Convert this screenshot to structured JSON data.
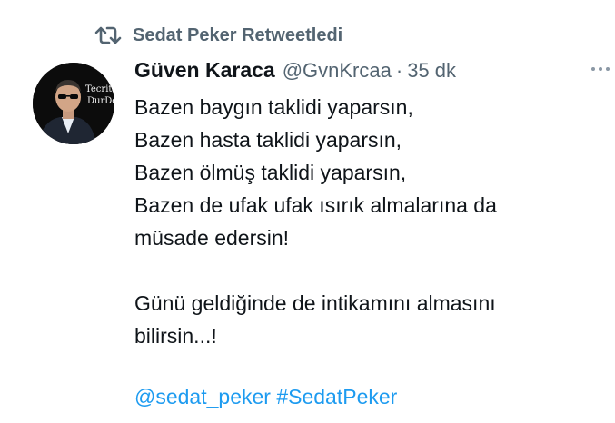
{
  "retweet": {
    "icon": "retweet-icon",
    "label": "Sedat Peker Retweetledi"
  },
  "author": {
    "avatar_text_top": "Tecrite",
    "avatar_text_bottom": "DurDe",
    "display_name": "Güven Karaca",
    "handle": "@GvnKrcaa",
    "separator": "·",
    "time": "35 dk"
  },
  "more_icon": "more-horizontal-icon",
  "tweet": {
    "lines": [
      "Bazen baygın taklidi yaparsın,",
      "Bazen hasta taklidi yaparsın,",
      "Bazen ölmüş taklidi yaparsın,",
      "Bazen de ufak ufak ısırık almalarına da",
      "müsade edersin!",
      "",
      "Günü geldiğinde de intikamını almasını",
      "bilirsin...!"
    ],
    "mention": "@sedat_peker",
    "hashtag": "#SedatPeker"
  },
  "colors": {
    "text": "#0f1419",
    "secondary": "#536471",
    "link": "#1d9bf0"
  }
}
